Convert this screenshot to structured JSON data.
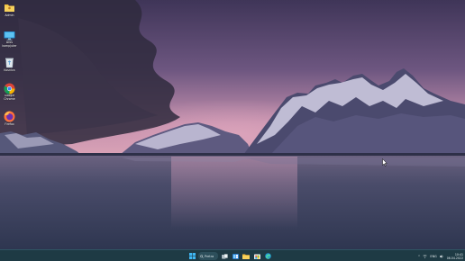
{
  "desktop": {
    "icons": [
      {
        "label": "Admin",
        "icon": "user-folder-icon"
      },
      {
        "label": "Bros kompjuter",
        "icon": "this-pc-icon"
      },
      {
        "label": "Kosnica",
        "icon": "recycle-bin-icon"
      },
      {
        "label": "Google Chrome",
        "icon": "chrome-icon"
      },
      {
        "label": "Firefox",
        "icon": "firefox-icon"
      }
    ]
  },
  "taskbar": {
    "search_label": "Pretra",
    "pinned": [
      "start-icon",
      "search-icon",
      "task-view-icon",
      "widgets-icon",
      "file-explorer-icon",
      "store-icon",
      "edge-icon"
    ],
    "tray": {
      "language": "ENG",
      "time": "10:41",
      "date": "06.04.2022"
    }
  },
  "colors": {
    "sky_top": "#4a3f66",
    "sky_glow": "#c58fb0",
    "water": "#3f4b66",
    "taskbar": "#1e3a44"
  }
}
